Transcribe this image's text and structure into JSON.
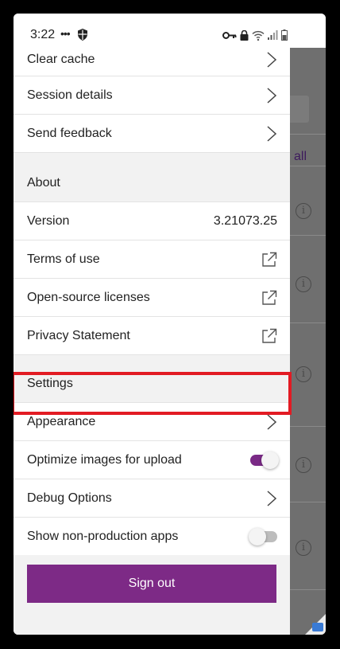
{
  "status_bar": {
    "time": "3:22",
    "dots": "•••"
  },
  "menu": {
    "clear_cache": "Clear cache",
    "session_details": "Session details",
    "send_feedback": "Send feedback",
    "about_header": "About",
    "version_label": "Version",
    "version_value": "3.21073.25",
    "terms_of_use": "Terms of use",
    "open_source_licenses": "Open-source licenses",
    "privacy_statement": "Privacy Statement",
    "settings_header": "Settings",
    "appearance": "Appearance",
    "optimize_images": "Optimize images for upload",
    "optimize_images_on": true,
    "debug_options": "Debug Options",
    "show_non_production": "Show non-production apps",
    "show_non_production_on": false,
    "sign_out": "Sign out"
  },
  "background_app": {
    "link_text": "all"
  },
  "colors": {
    "accent": "#7d2a86",
    "highlight": "#e21b23"
  }
}
